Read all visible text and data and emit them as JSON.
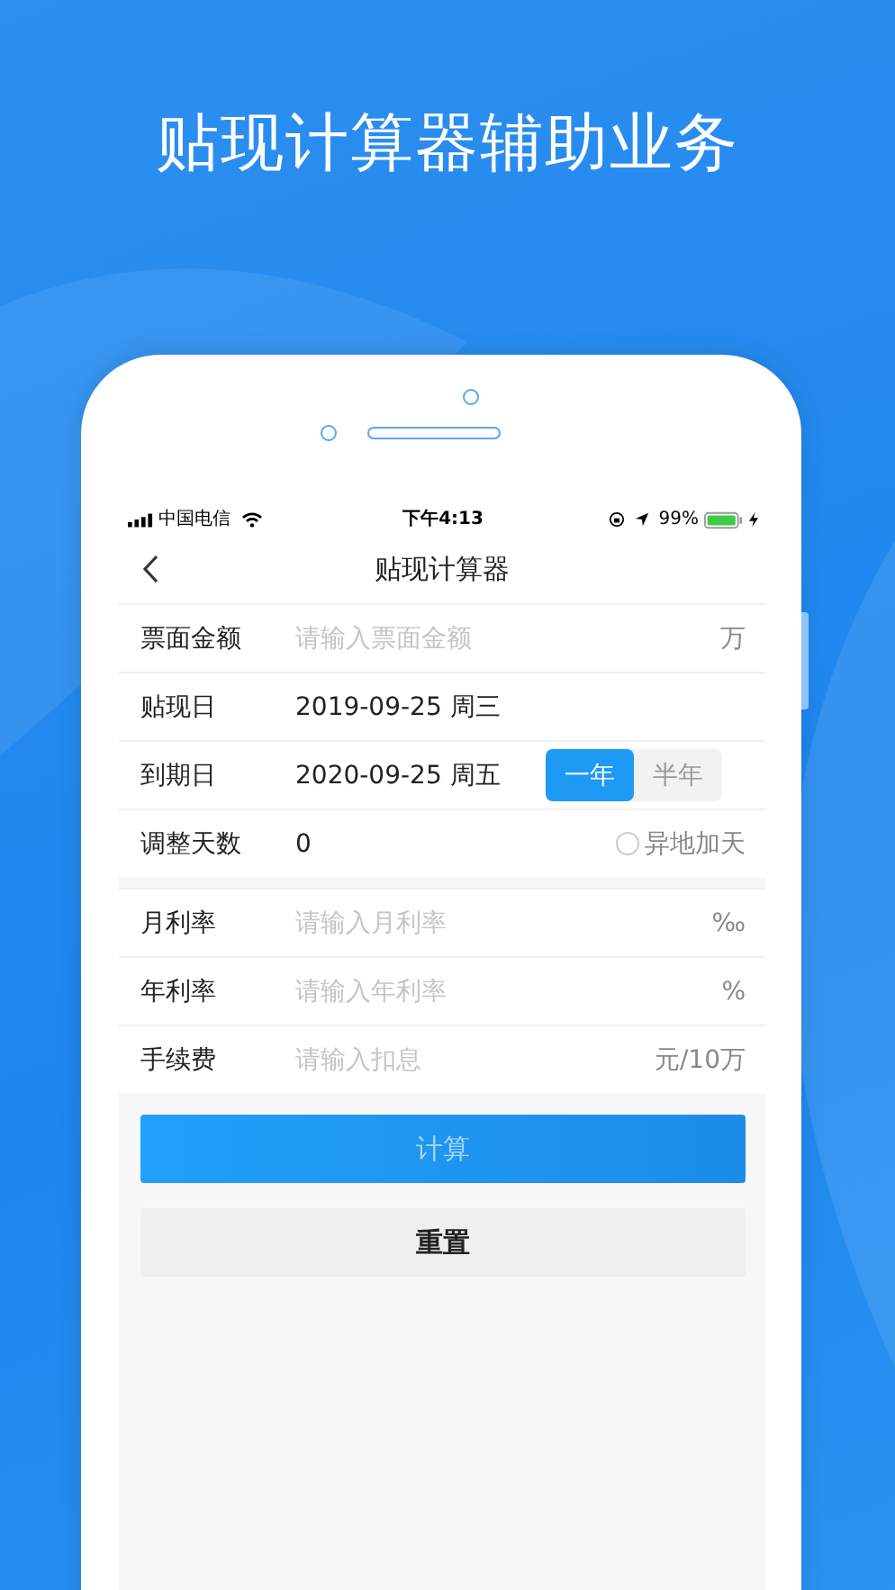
{
  "headline": "贴现计算器辅助业务",
  "status_bar": {
    "carrier": "中国电信",
    "time": "下午4:13",
    "battery": "99%"
  },
  "nav": {
    "title": "贴现计算器"
  },
  "form_rows": [
    {
      "kind": "input",
      "label": "票面金额",
      "placeholder": "请输入票面金额",
      "unit": "万"
    },
    {
      "kind": "date",
      "label": "贴现日",
      "value": "2019-09-25 周三"
    },
    {
      "kind": "date_toggle",
      "label": "到期日",
      "value": "2020-09-25 周五",
      "options": [
        {
          "label": "一年",
          "selected": true
        },
        {
          "label": "半年",
          "selected": false
        }
      ]
    },
    {
      "kind": "days_check",
      "label": "调整天数",
      "value": "0",
      "check": {
        "label": "异地加天",
        "checked": false
      }
    }
  ],
  "rate_rows": [
    {
      "kind": "input",
      "label": "月利率",
      "placeholder": "请输入月利率",
      "unit": "‰"
    },
    {
      "kind": "input",
      "label": "年利率",
      "placeholder": "请输入年利率",
      "unit": "%"
    },
    {
      "kind": "input",
      "label": "手续费",
      "placeholder": "请输入扣息",
      "unit": "元/10万"
    }
  ],
  "calculate_button": {
    "label": "计算",
    "disabled": true
  },
  "reset_button": {
    "label": "重置"
  }
}
